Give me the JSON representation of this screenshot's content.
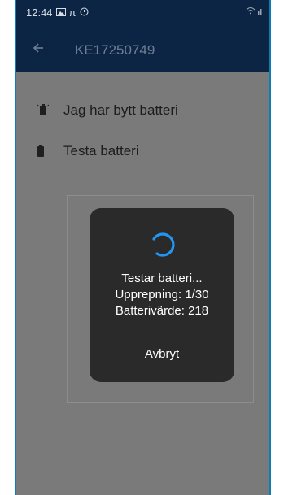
{
  "statusbar": {
    "time": "12:44",
    "icons_left": [
      "image-icon",
      "pi-icon",
      "clock-icon"
    ],
    "icons_right": [
      "wifi-icon",
      "signal-icon"
    ]
  },
  "appbar": {
    "back_icon": "arrow-left-icon",
    "title": "KE17250749"
  },
  "menu": {
    "items": [
      {
        "label": "Jag har bytt batteri",
        "icon": "battery-changed-icon"
      },
      {
        "label": "Testa batteri",
        "icon": "battery-icon"
      }
    ]
  },
  "dialog": {
    "status": "Testar batteri...",
    "repetition": "Upprepning: 1/30",
    "battery_value": "Batterivärde: 218",
    "cancel_label": "Avbryt",
    "spinner_color": "#2196f3"
  },
  "colors": {
    "appbar": "#0c2545",
    "overlay": "#7a7a7a",
    "dialog": "#2a2a2a",
    "accent": "#0b7fb5"
  }
}
